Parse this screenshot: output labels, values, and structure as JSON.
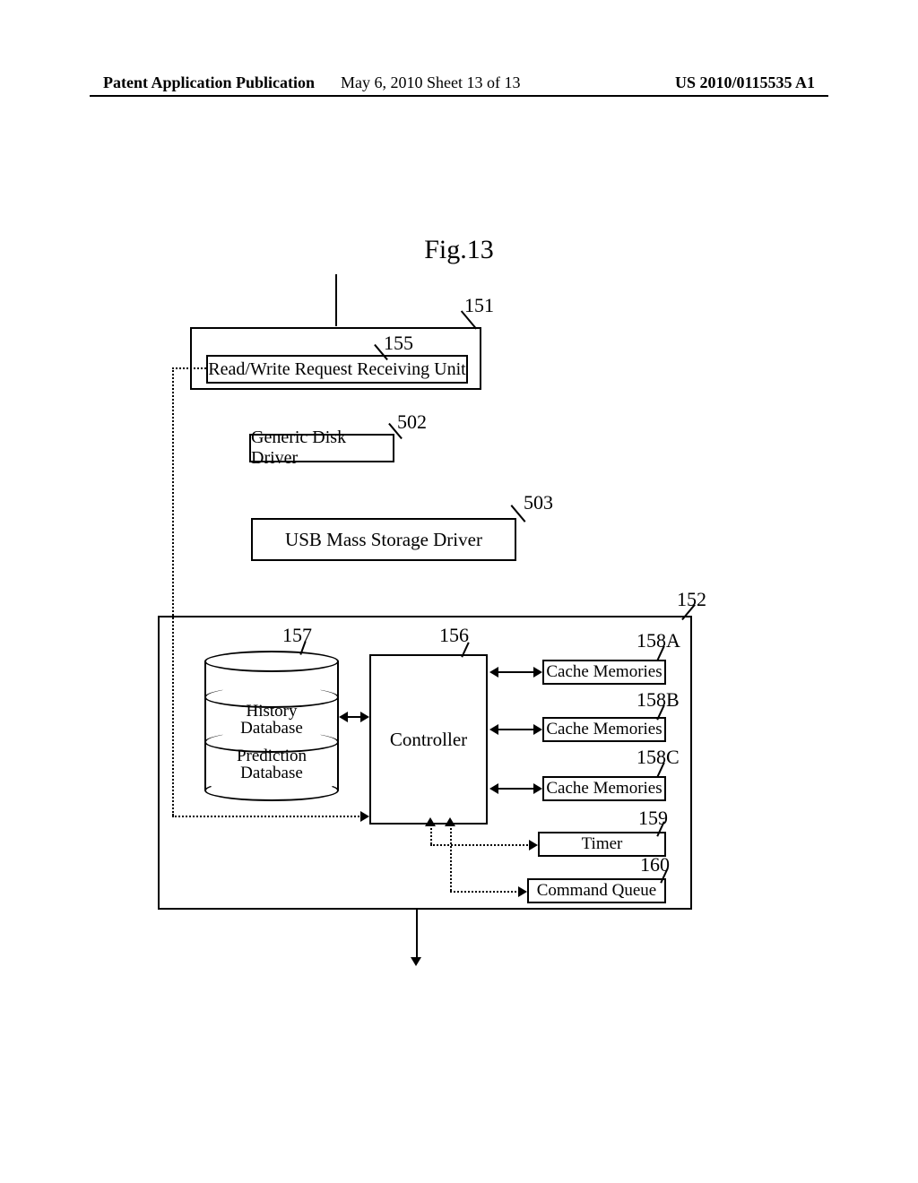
{
  "header": {
    "left": "Patent Application Publication",
    "date": "May 6, 2010",
    "sheet": "Sheet 13 of 13",
    "pubno": "US 2010/0115535 A1",
    "mid": "May 6, 2010   Sheet 13 of 13"
  },
  "figure_title": "Fig.13",
  "refs": {
    "r151": "151",
    "r155": "155",
    "r502": "502",
    "r503": "503",
    "r152": "152",
    "r156": "156",
    "r157": "157",
    "r158A": "158A",
    "r158B": "158B",
    "r158C": "158C",
    "r159": "159",
    "r160": "160"
  },
  "boxes": {
    "receiving_unit": "Read/Write Request Receiving Unit",
    "generic_driver": "Generic Disk Driver",
    "usb_driver": "USB Mass Storage Driver",
    "controller": "Controller",
    "cacheA": "Cache Memories",
    "cacheB": "Cache Memories",
    "cacheC": "Cache Memories",
    "timer": "Timer",
    "cmd_queue": "Command Queue",
    "history_db": "History\nDatabase",
    "prediction_db": "Prediction\nDatabase"
  }
}
